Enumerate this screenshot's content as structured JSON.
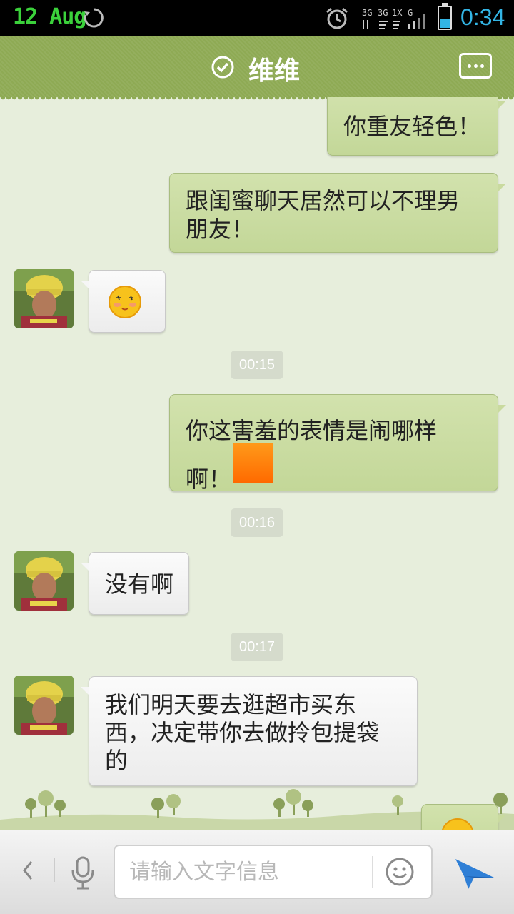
{
  "status_bar": {
    "date": "12 Aug",
    "time": "0:34",
    "network": "3G 3G 1X G"
  },
  "header": {
    "title": "维维",
    "verified_icon": "check-circle-icon",
    "more_icon": "more-icon"
  },
  "messages": [
    {
      "side": "out",
      "text": "你重友轻色！"
    },
    {
      "side": "out",
      "text": "跟闺蜜聊天居然可以不理男朋友！"
    },
    {
      "side": "in",
      "type": "emoji",
      "emoji": "shy-face-icon"
    },
    {
      "type": "time",
      "text": "00:15"
    },
    {
      "side": "out",
      "text": "你这害羞的表情是闹哪样啊！",
      "emoji": "orange-square-icon"
    },
    {
      "type": "time",
      "text": "00:16"
    },
    {
      "side": "in",
      "text": "没有啊"
    },
    {
      "type": "time",
      "text": "00:17"
    },
    {
      "side": "in",
      "text": "我们明天要去逛超市买东西，决定带你去做拎包提袋的"
    }
  ],
  "input_bar": {
    "placeholder": "请输入文字信息",
    "value": ""
  },
  "colors": {
    "header": "#8eaa54",
    "background": "#e7eedc",
    "out_bubble": "#c9da9f",
    "in_bubble": "#f4f4f4",
    "status_time": "#33b5e5",
    "status_date": "#3bd13b",
    "send": "#2f7fd6"
  }
}
